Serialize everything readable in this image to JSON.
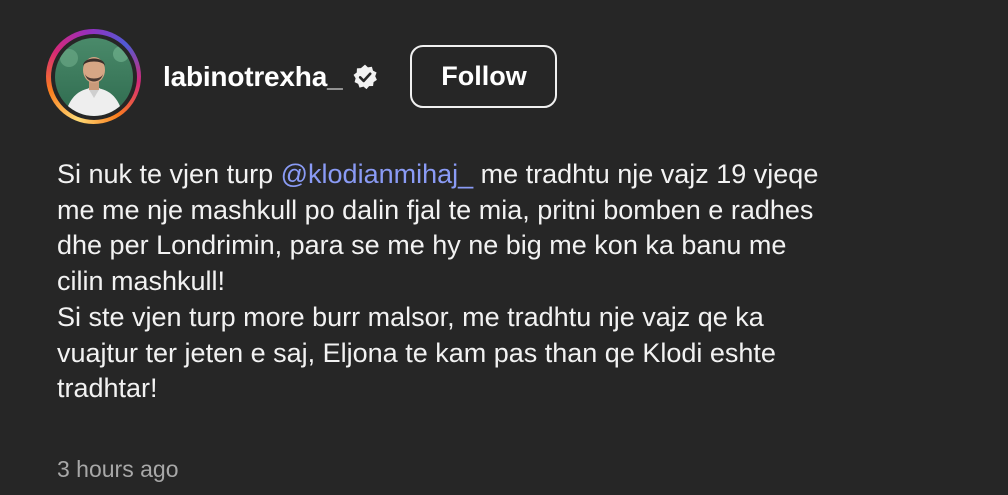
{
  "post": {
    "username": "labinotrexha_",
    "verified": true,
    "avatar_icon": "profile-photo",
    "story_ring_colors": [
      "#feda75",
      "#fa7e1e",
      "#d62976",
      "#962fbf",
      "#4f5bd5"
    ],
    "follow_label": "Follow",
    "caption": {
      "line1_before": "Si nuk te vjen turp ",
      "mention": "@klodianmihaj_",
      "line1_after": "  me tradhtu nje vajz 19 vjeqe",
      "line2": "me me nje mashkull po dalin fjal te mia, pritni bomben e radhes",
      "line3": "dhe per Londrimin, para se me hy ne big me kon ka banu me",
      "line4": "cilin mashkull!",
      "line5": "Si ste vjen turp more burr malsor, me tradhtu nje vajz qe ka",
      "line6": "vuajtur ter jeten e saj, Eljona te kam pas than qe Klodi eshte",
      "line7": "tradhtar!"
    },
    "timestamp": "3 hours ago",
    "mention_color": "#8a9bf5"
  }
}
